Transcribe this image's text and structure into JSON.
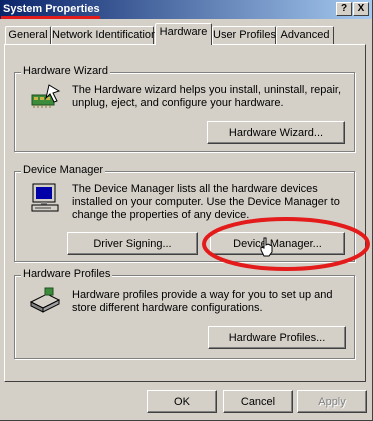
{
  "window": {
    "title": "System Properties",
    "help_label": "?",
    "close_label": "X"
  },
  "tabs": [
    {
      "label": "General",
      "active": false
    },
    {
      "label": "Network Identification",
      "active": false
    },
    {
      "label": "Hardware",
      "active": true
    },
    {
      "label": "User Profiles",
      "active": false
    },
    {
      "label": "Advanced",
      "active": false
    }
  ],
  "hardware_wizard": {
    "title": "Hardware Wizard",
    "description": "The Hardware wizard helps you install, uninstall, repair, unplug, eject, and configure your hardware.",
    "button_label": "Hardware Wizard..."
  },
  "device_manager": {
    "title": "Device Manager",
    "description": "The Device Manager lists all the hardware devices installed on your computer. Use the Device Manager to change the properties of any device.",
    "driver_signing_label": "Driver Signing...",
    "button_label": "Device Manager..."
  },
  "hardware_profiles": {
    "title": "Hardware Profiles",
    "description": "Hardware profiles provide a way for you to set up and store different hardware configurations.",
    "button_label": "Hardware Profiles..."
  },
  "footer": {
    "ok_label": "OK",
    "cancel_label": "Cancel",
    "apply_label": "Apply"
  },
  "colors": {
    "annotation_red": "#e41b1b",
    "face": "#d4d0c8",
    "titlebar_start": "#0a246a",
    "titlebar_end": "#a6caf0"
  }
}
